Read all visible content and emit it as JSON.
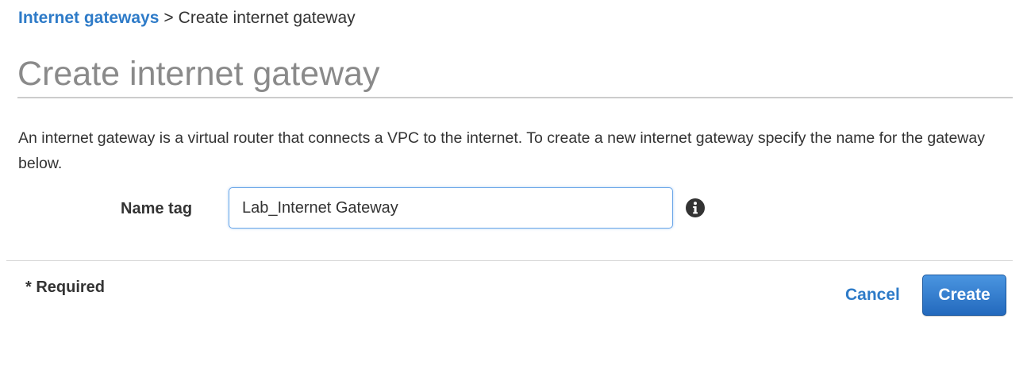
{
  "breadcrumb": {
    "parent_label": "Internet gateways",
    "separator": ">",
    "current_label": "Create internet gateway"
  },
  "page": {
    "title": "Create internet gateway",
    "description": "An internet gateway is a virtual router that connects a VPC to the internet. To create a new internet gateway specify the name for the gateway below."
  },
  "form": {
    "name_tag_label": "Name tag",
    "name_tag_value": "Lab_Internet Gateway",
    "info_icon": "info-circle-icon"
  },
  "footer": {
    "required_note": "* Required",
    "cancel_label": "Cancel",
    "create_label": "Create"
  },
  "colors": {
    "link": "#2e7bc8",
    "primary_button": "#2369bd",
    "title_gray": "#8a8a8a",
    "input_focus_border": "#6aa6e8"
  }
}
